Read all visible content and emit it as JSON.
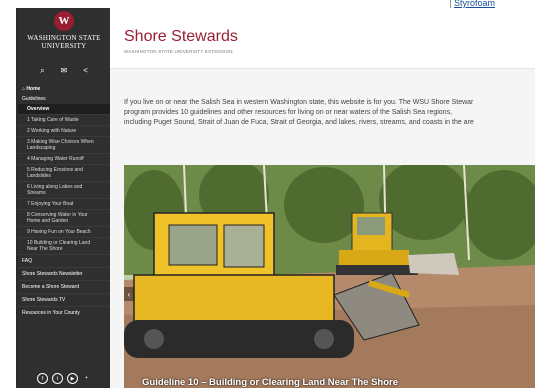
{
  "corner": {
    "link": "Styrofoam"
  },
  "sidebar": {
    "logo_name_1": "WASHINGTON STATE",
    "logo_name_2": "UNIVERSITY",
    "home": "Home",
    "guidelines": "Guidelines",
    "overview": "Overview",
    "items": [
      "1 Taking Care of Waste",
      "2 Working with Nature",
      "3 Making Wise Choices When Landscaping",
      "4 Managing Water Runoff",
      "5 Reducing Erosions and Landslides",
      "6 Living along Lakes and Streams",
      "7 Enjoying Your Boat",
      "8 Conserving Water in Your Home and Garden",
      "9 Having Fun on Your Beach",
      "10 Building or Clearing Land Near The Shore"
    ],
    "faq": "FAQ",
    "newsletter": "Shore Stewards Newsletter",
    "become": "Become a Shore Steward",
    "tv": "Shore Stewards TV",
    "resources": "Resources in Your County"
  },
  "header": {
    "title": "Shore Stewards",
    "subtitle": "WASHINGTON STATE UNIVERSITY EXTENSION"
  },
  "intro": {
    "line1": "If you live on or near the Salish Sea in western Washington state, this website is for you. The WSU Shore Stewar",
    "line2": "program provides 10 guidelines and other resources for living on or near waters of the Salish Sea regions,",
    "line3": "including Puget Sound, Strait of Juan de Fuca, Strait of Georgia, and lakes, rivers, streams, and coasts in the are"
  },
  "hero": {
    "caption": "Guideline 10 – Building or Clearing Land Near The Shore"
  }
}
